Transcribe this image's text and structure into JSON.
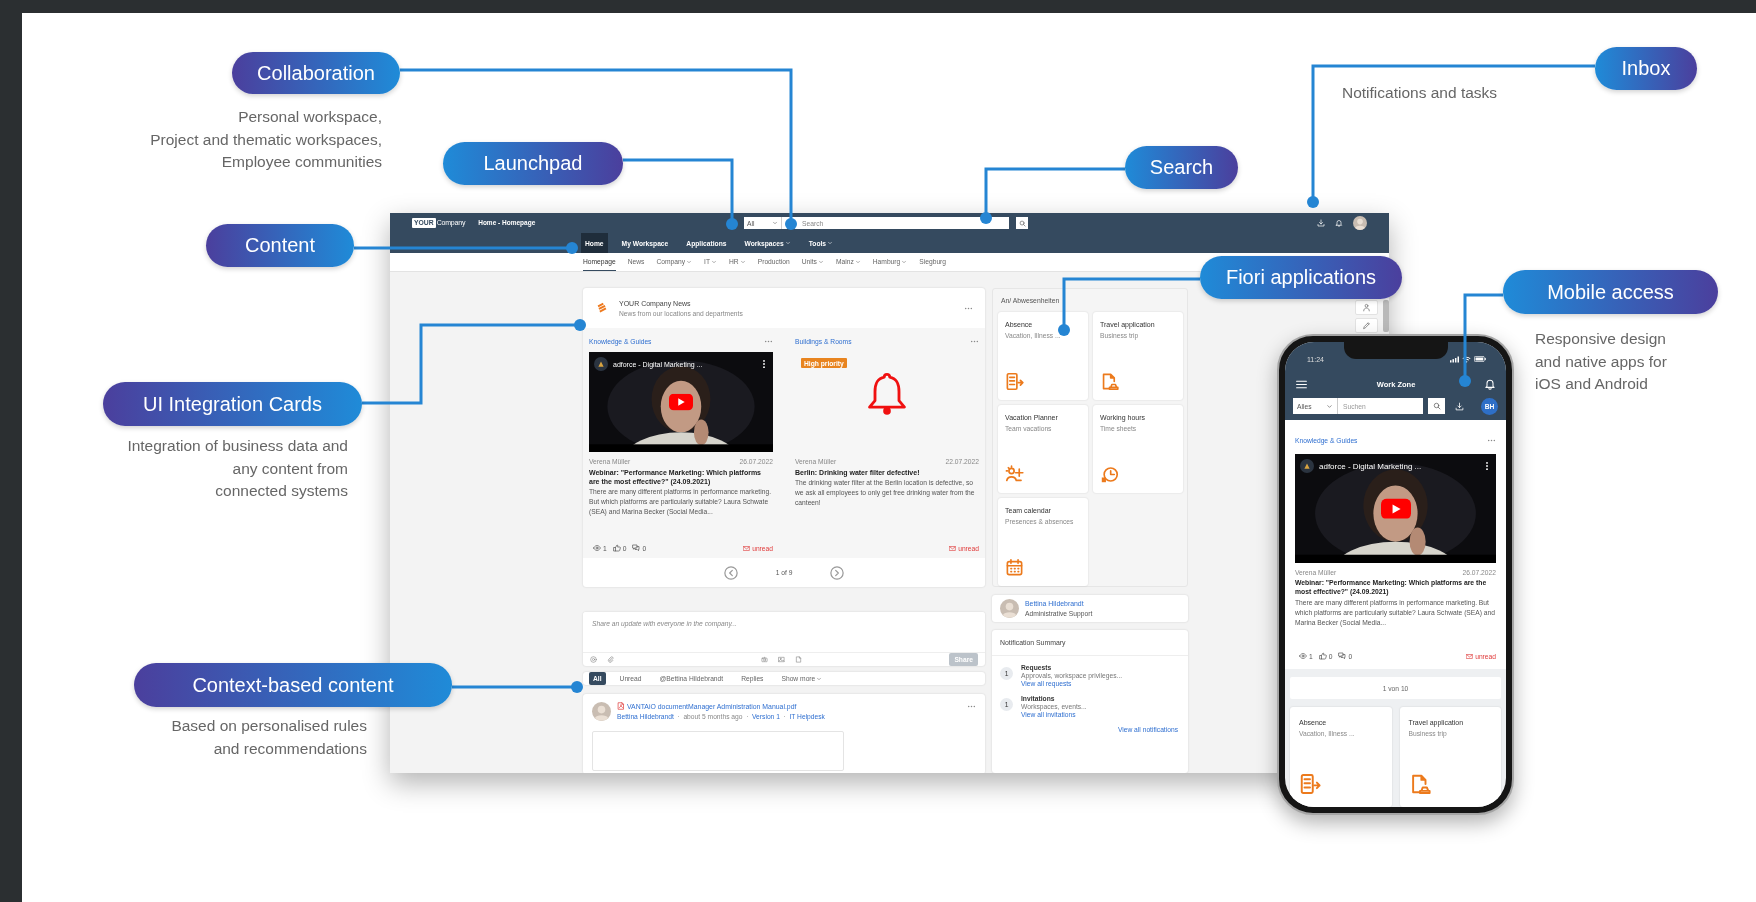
{
  "callouts": [
    {
      "label": "Collaboration",
      "lines": [
        "Personal workspace,",
        "Project and thematic workspaces,",
        "Employee communities"
      ]
    },
    {
      "label": "Inbox",
      "lines": [
        "Notifications and tasks"
      ]
    },
    {
      "label": "Launchpad"
    },
    {
      "label": "Search"
    },
    {
      "label": "Content"
    },
    {
      "label": "Fiori applications"
    },
    {
      "label": "Mobile access",
      "lines": [
        "Responsive design",
        "and native apps for",
        "iOS and Android"
      ]
    },
    {
      "label": "UI Integration Cards",
      "lines": [
        "Integration of business data and",
        "any content from",
        "connected systems"
      ]
    },
    {
      "label": "Context-based content",
      "lines": [
        "Based on personalised rules",
        "and recommendations"
      ]
    }
  ],
  "desktop": {
    "shell": {
      "logo_mark": "YOUR",
      "logo_text": "Company",
      "title": "Home - Homepage",
      "search_scope": "All",
      "search_placeholder": "Search"
    },
    "nav": [
      {
        "label": "Home",
        "selected": true,
        "dropdown": false
      },
      {
        "label": "My Workspace",
        "selected": false,
        "dropdown": false
      },
      {
        "label": "Applications",
        "selected": false,
        "dropdown": false
      },
      {
        "label": "Workspaces",
        "selected": false,
        "dropdown": true
      },
      {
        "label": "Tools",
        "selected": false,
        "dropdown": true
      }
    ],
    "subnav": [
      {
        "label": "Homepage",
        "selected": true,
        "dropdown": false
      },
      {
        "label": "News",
        "selected": false,
        "dropdown": false
      },
      {
        "label": "Company",
        "selected": false,
        "dropdown": true
      },
      {
        "label": "IT",
        "selected": false,
        "dropdown": true
      },
      {
        "label": "HR",
        "selected": false,
        "dropdown": true
      },
      {
        "label": "Production",
        "selected": false,
        "dropdown": false
      },
      {
        "label": "Units",
        "selected": false,
        "dropdown": true
      },
      {
        "label": "Mainz",
        "selected": false,
        "dropdown": true
      },
      {
        "label": "Hamburg",
        "selected": false,
        "dropdown": true
      },
      {
        "label": "Siegburg",
        "selected": false,
        "dropdown": false
      }
    ],
    "news_card": {
      "title": "YOUR Company News",
      "subtitle": "News from our locations and departments",
      "pager": "1 of 9",
      "items": [
        {
          "kind": "video",
          "category": "Knowledge & Guides",
          "video_title": "adforce - Digital Marketing ...",
          "author": "Verena Müller",
          "date": "26.07.2022",
          "title": "Webinar: \"Performance Marketing: Which platforms are the most effective?\" (24.09.2021)",
          "text": "There are many different platforms in performance marketing. But which platforms are particularly suitable? Laura Schwate (SEA) and Marina Becker (Social Media...",
          "stats": {
            "views": "1",
            "likes": "0",
            "comments": "0"
          },
          "status": "unread"
        },
        {
          "kind": "alert",
          "category": "Buildings & Rooms",
          "badge": "High priority",
          "author": "Verena Müller",
          "date": "22.07.2022",
          "title": "Berlin: Drinking water filter defective!",
          "text": "The drinking water filter at the Berlin location is defective, so we ask all employees to only get free drinking water from the canteen!",
          "status": "unread"
        }
      ]
    },
    "share_box": {
      "placeholder": "Share an update with everyone in the company...",
      "button": "Share",
      "disabled": true
    },
    "feed_filters": [
      {
        "label": "All",
        "selected": true,
        "dropdown": false
      },
      {
        "label": "Unread",
        "selected": false,
        "dropdown": false
      },
      {
        "label": "@Bettina Hildebrandt",
        "selected": false,
        "dropdown": false
      },
      {
        "label": "Replies",
        "selected": false,
        "dropdown": false
      },
      {
        "label": "Show more",
        "selected": false,
        "dropdown": true
      }
    ],
    "feed_post": {
      "title": "VANTAiO documentManager Administration Manual.pdf",
      "meta": [
        {
          "text": "Bettina Hildebrandt",
          "link": true
        },
        {
          "text": "about 5 months ago",
          "link": false
        },
        {
          "text": "Version 1",
          "link": true
        },
        {
          "text": "IT Helpdesk",
          "link": true
        }
      ]
    },
    "absence_panel": {
      "title": "An/ Abwesenheiten",
      "tiles": [
        {
          "title": "Absence",
          "subtitle": "Vacation, Illness ...",
          "kind": "absence"
        },
        {
          "title": "Travel application",
          "subtitle": "Business trip",
          "kind": "travel"
        },
        {
          "title": "Vacation Planner",
          "subtitle": "Team vacations",
          "kind": "planner"
        },
        {
          "title": "Working hours",
          "subtitle": "Time sheets",
          "kind": "hours"
        },
        {
          "title": "Team calendar",
          "subtitle": "Presences & absences",
          "kind": "calendar"
        }
      ]
    },
    "profile": {
      "name": "Bettina Hildebrandt",
      "role": "Administrative Support"
    },
    "notifications": {
      "title": "Notification Summary",
      "footer_link": "View all notifications",
      "items": [
        {
          "count": "1",
          "title": "Requests",
          "text": "Approvals, workspace privileges...",
          "link": "View all requests"
        },
        {
          "count": "1",
          "title": "Invitations",
          "text": "Workspaces, events...",
          "link": "View all invitations"
        }
      ]
    }
  },
  "phone": {
    "time": "11:24",
    "title": "Work Zone",
    "search_scope": "Alles",
    "search_placeholder": "Suchen",
    "avatar_initials": "BH",
    "news_item": {
      "kind": "video",
      "category": "Knowledge & Guides",
      "video_title": "adforce - Digital Marketing ...",
      "author": "Verena Müller",
      "date": "26.07.2022",
      "title": "Webinar: \"Performance Marketing: Which platforms are the most effective?\" (24.09.2021)",
      "text": "There are many different platforms in performance marketing. But which platforms are particularly suitable? Laura Schwate (SEA) and Marina Becker (Social Media...",
      "stats": {
        "views": "1",
        "likes": "0",
        "comments": "0"
      },
      "status": "unread"
    },
    "pager": "1 von 10",
    "tiles": [
      {
        "title": "Absence",
        "subtitle": "Vacation, Illness ...",
        "kind": "absence"
      },
      {
        "title": "Travel application",
        "subtitle": "Business trip",
        "kind": "travel"
      }
    ]
  }
}
